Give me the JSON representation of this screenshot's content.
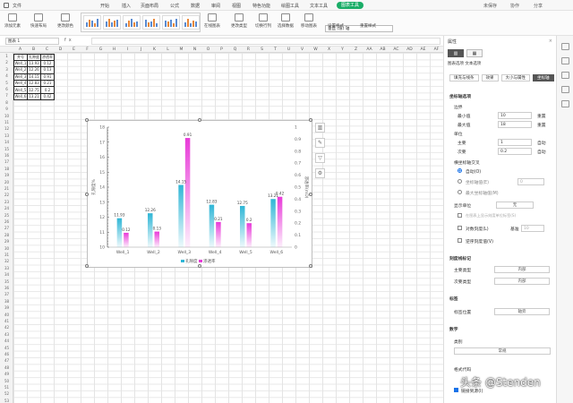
{
  "menubar": {
    "items": [
      "文件",
      "开始",
      "插入",
      "页面布局",
      "公式",
      "数据",
      "审阅",
      "视图",
      "特色功能",
      "绘图工具",
      "文本工具",
      "图表工具"
    ],
    "active_index": 11,
    "right": [
      "未保存",
      "协作",
      "分享"
    ]
  },
  "ribbon": {
    "buttons": [
      "添加元素",
      "快速布局",
      "更改颜色",
      "在线图表",
      "更改类型",
      "切换行列",
      "选择数据",
      "移动图表",
      "设置格式",
      "重置样式"
    ],
    "selector": "垂直 (值) 轴"
  },
  "formula": {
    "namebox": "图表 1",
    "fx": "fx"
  },
  "columns": [
    "A",
    "B",
    "C",
    "D",
    "E",
    "F",
    "G",
    "H",
    "I",
    "J",
    "K",
    "L",
    "M",
    "N",
    "O",
    "P",
    "Q",
    "R",
    "S",
    "T",
    "U",
    "V",
    "W",
    "X",
    "Y",
    "Z",
    "AA",
    "AB",
    "AC",
    "AD",
    "AE",
    "AF",
    "AG"
  ],
  "table": {
    "headers": [
      "井号",
      "孔隙度",
      "渗透率"
    ],
    "rows": [
      [
        "Well_1",
        "13.93",
        "0.12"
      ],
      [
        "Well_2",
        "12.26",
        "0.13"
      ],
      [
        "Well_3",
        "14.15",
        "0.91"
      ],
      [
        "Well_4",
        "12.83",
        "0.21"
      ],
      [
        "Well_5",
        "12.75",
        "0.2"
      ],
      [
        "Well_6",
        "13.21",
        "0.42"
      ]
    ]
  },
  "chart_data": {
    "type": "bar",
    "categories": [
      "Well_1",
      "Well_2",
      "Well_3",
      "Well_4",
      "Well_5",
      "Well_6"
    ],
    "series": [
      {
        "name": "孔隙度",
        "values": [
          11.93,
          12.26,
          14.15,
          12.83,
          12.75,
          13.21
        ],
        "axis": "left",
        "color": "#2fb6d6"
      },
      {
        "name": "渗透率",
        "values": [
          0.12,
          0.13,
          0.91,
          0.21,
          0.2,
          0.42
        ],
        "axis": "right",
        "color": "#e83ad8"
      }
    ],
    "ylabel_left": "孔隙度%",
    "ylabel_right": "渗透率(mD)",
    "left_ticks": [
      "18",
      "17",
      "16",
      "15",
      "14",
      "13",
      "12",
      "11",
      "10"
    ],
    "left_range": [
      10,
      18
    ],
    "right_ticks": [
      "1",
      "0.9",
      "0.8",
      "0.7",
      "0.6",
      "0.5",
      "0.4",
      "0.3",
      "0.2",
      "0.1",
      "0"
    ],
    "right_range": [
      0,
      1
    ],
    "legend": "bottom",
    "grid": false
  },
  "panel": {
    "title": "属性",
    "close": "×",
    "subtitle": "图表选项  文本选项",
    "subtabs": [
      "填充与线条",
      "效果",
      "大小与属性",
      "坐标轴"
    ],
    "sec1": "坐标轴选项",
    "bounds": "边界",
    "min_label": "最小值",
    "min_val": "10",
    "max_label": "最大值",
    "max_val": "18",
    "reset": "重置",
    "units": "单位",
    "major_label": "主要",
    "major_val": "1",
    "minor_label": "次要",
    "minor_val": "0.2",
    "auto": "自动",
    "cross": "横坐标轴交叉",
    "cross_auto": "自动(O)",
    "cross_value": "坐标轴值(E)",
    "cross_value_input": "0",
    "cross_max": "最大坐标轴值(M)",
    "display_units": "显示单位",
    "display_val": "无",
    "display_chk": "在图表上显示刻度单位标签(S)",
    "log_label": "对数刻度(L)",
    "base_label": "基准",
    "base_val": "10",
    "reverse_label": "逆序刻度值(V)",
    "sec2": "刻度线标记",
    "major_type": "主要类型",
    "major_type_val": "内部",
    "minor_type": "次要类型",
    "minor_type_val": "内部",
    "sec3": "标签",
    "label_pos": "标签位置",
    "label_pos_val": "轴旁",
    "sec4": "数字",
    "category": "类别",
    "category_val": "常规",
    "format_code": "格式代码",
    "link_source": "链接到源(I)"
  },
  "watermark": "头条 @Stenden"
}
